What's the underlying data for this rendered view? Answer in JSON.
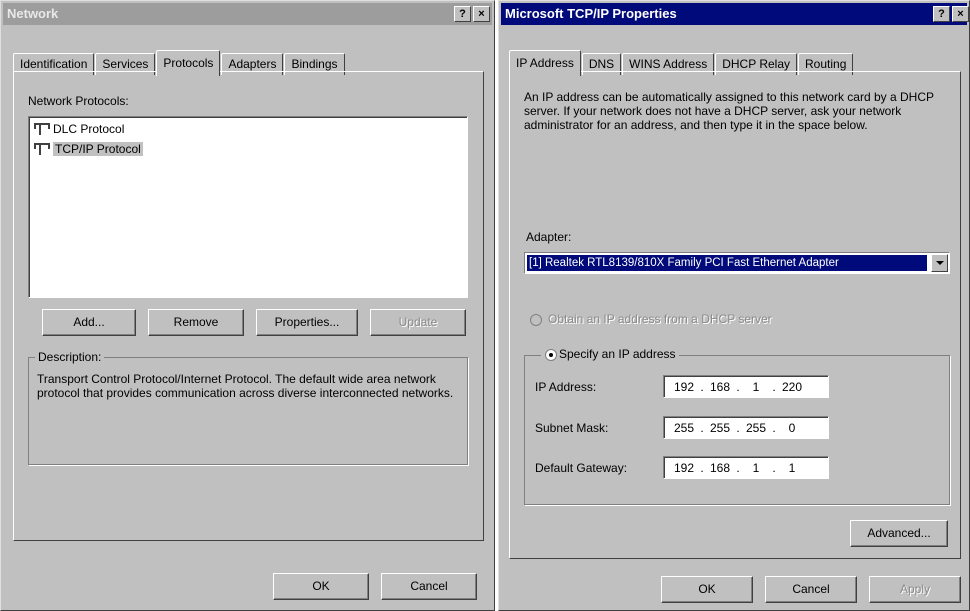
{
  "network_window": {
    "title": "Network",
    "help_glyph": "?",
    "close_glyph": "×",
    "tabs": [
      "Identification",
      "Services",
      "Protocols",
      "Adapters",
      "Bindings"
    ],
    "selected_tab": "Protocols",
    "protocols_label": "Network Protocols:",
    "protocols": [
      "DLC Protocol",
      "TCP/IP Protocol"
    ],
    "selected_protocol": "TCP/IP Protocol",
    "buttons": {
      "add": "Add...",
      "remove": "Remove",
      "properties": "Properties...",
      "update": "Update"
    },
    "description_title": "Description:",
    "description_text": "Transport Control Protocol/Internet Protocol. The default wide area network protocol that provides communication across diverse interconnected networks.",
    "ok": "OK",
    "cancel": "Cancel"
  },
  "tcpip_window": {
    "title": "Microsoft TCP/IP Properties",
    "help_glyph": "?",
    "close_glyph": "×",
    "tabs": [
      "IP Address",
      "DNS",
      "WINS Address",
      "DHCP Relay",
      "Routing"
    ],
    "selected_tab": "IP Address",
    "intro_text": "An IP address can be automatically assigned to this network card by a DHCP server.  If your network does not have a DHCP server, ask your network administrator for an address, and then type it in the space below.",
    "adapter_label": "Adapter:",
    "adapter_value": "[1] Realtek RTL8139/810X Family PCI Fast Ethernet Adapter",
    "radio_dhcp": "Obtain an IP address from a DHCP server",
    "radio_specify": "Specify an IP address",
    "ip_label": "IP Address:",
    "ip_value": [
      "192",
      "168",
      "1",
      "220"
    ],
    "subnet_label": "Subnet Mask:",
    "subnet_value": [
      "255",
      "255",
      "255",
      "0"
    ],
    "gateway_label": "Default Gateway:",
    "gateway_value": [
      "192",
      "168",
      "1",
      "1"
    ],
    "advanced": "Advanced...",
    "ok": "OK",
    "cancel": "Cancel",
    "apply": "Apply"
  },
  "colors": {
    "active_titlebar": "#000a7a",
    "inactive_titlebar": "#9d9d9d",
    "face": "#c0c0c0"
  }
}
